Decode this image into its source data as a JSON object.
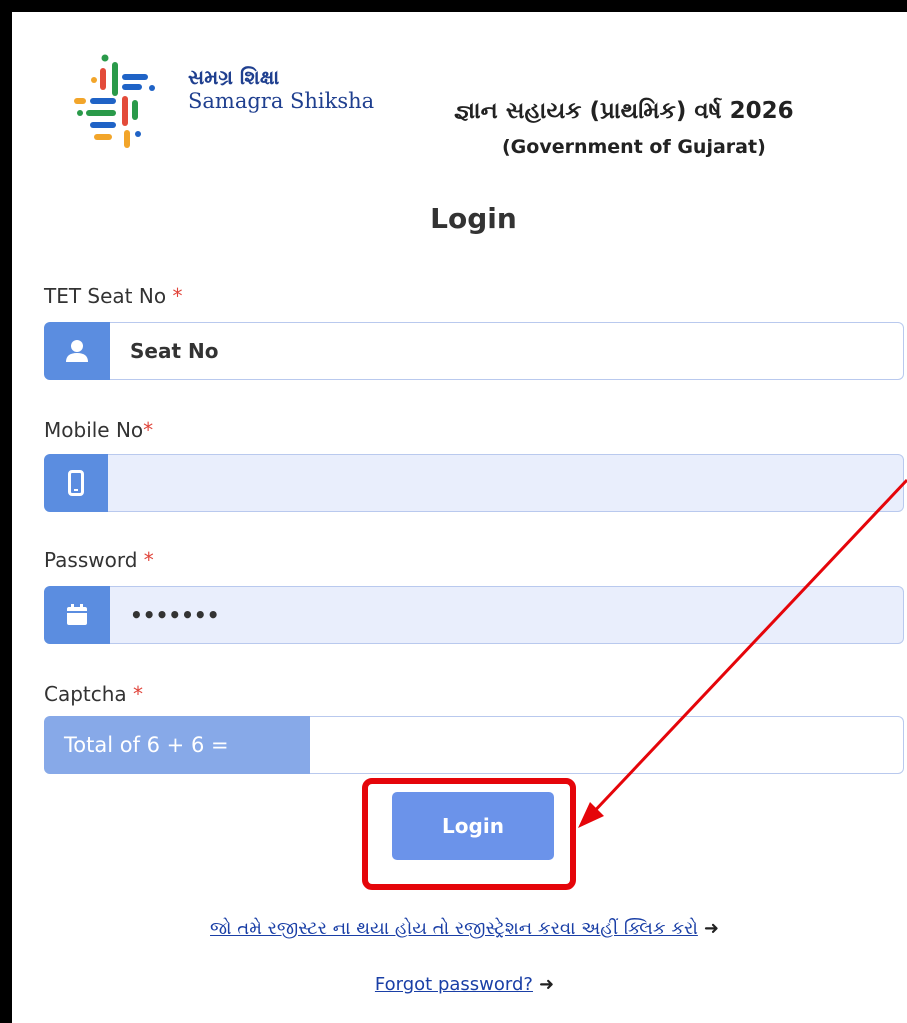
{
  "logo": {
    "name_gujarati": "સમગ્ર શિક્ષા",
    "name_english": "Samagra Shiksha",
    "icon": "samagra-shiksha-logo"
  },
  "header": {
    "title": "જ્ઞાન સહાયક (પ્રાથમિક) વર્ષ 2026",
    "subtitle": "(Government of Gujarat)"
  },
  "form": {
    "title": "Login",
    "seat_no": {
      "label": "TET Seat No",
      "required_mark": "*",
      "placeholder": "Seat No",
      "value": "",
      "icon": "user-icon"
    },
    "mobile_no": {
      "label": "Mobile No",
      "required_mark": "*",
      "value": "",
      "icon": "mobile-icon"
    },
    "password": {
      "label": "Password",
      "required_mark": "*",
      "value": "•••••••",
      "icon": "calendar-icon"
    },
    "captcha": {
      "label": "Captcha",
      "required_mark": "*",
      "question": "Total of 6 + 6 =",
      "value": ""
    },
    "submit_label": "Login"
  },
  "links": {
    "register": "જો તમે રજીસ્ટર ના થયા હોય તો રજીસ્ટ્રેશન કરવા અહીં ક્લિક કરો",
    "forgot": "Forgot password?",
    "arrow_icon": "sign-in-icon",
    "arrow_glyph": "➜"
  },
  "annotation": {
    "highlight_color": "#e5050a"
  }
}
